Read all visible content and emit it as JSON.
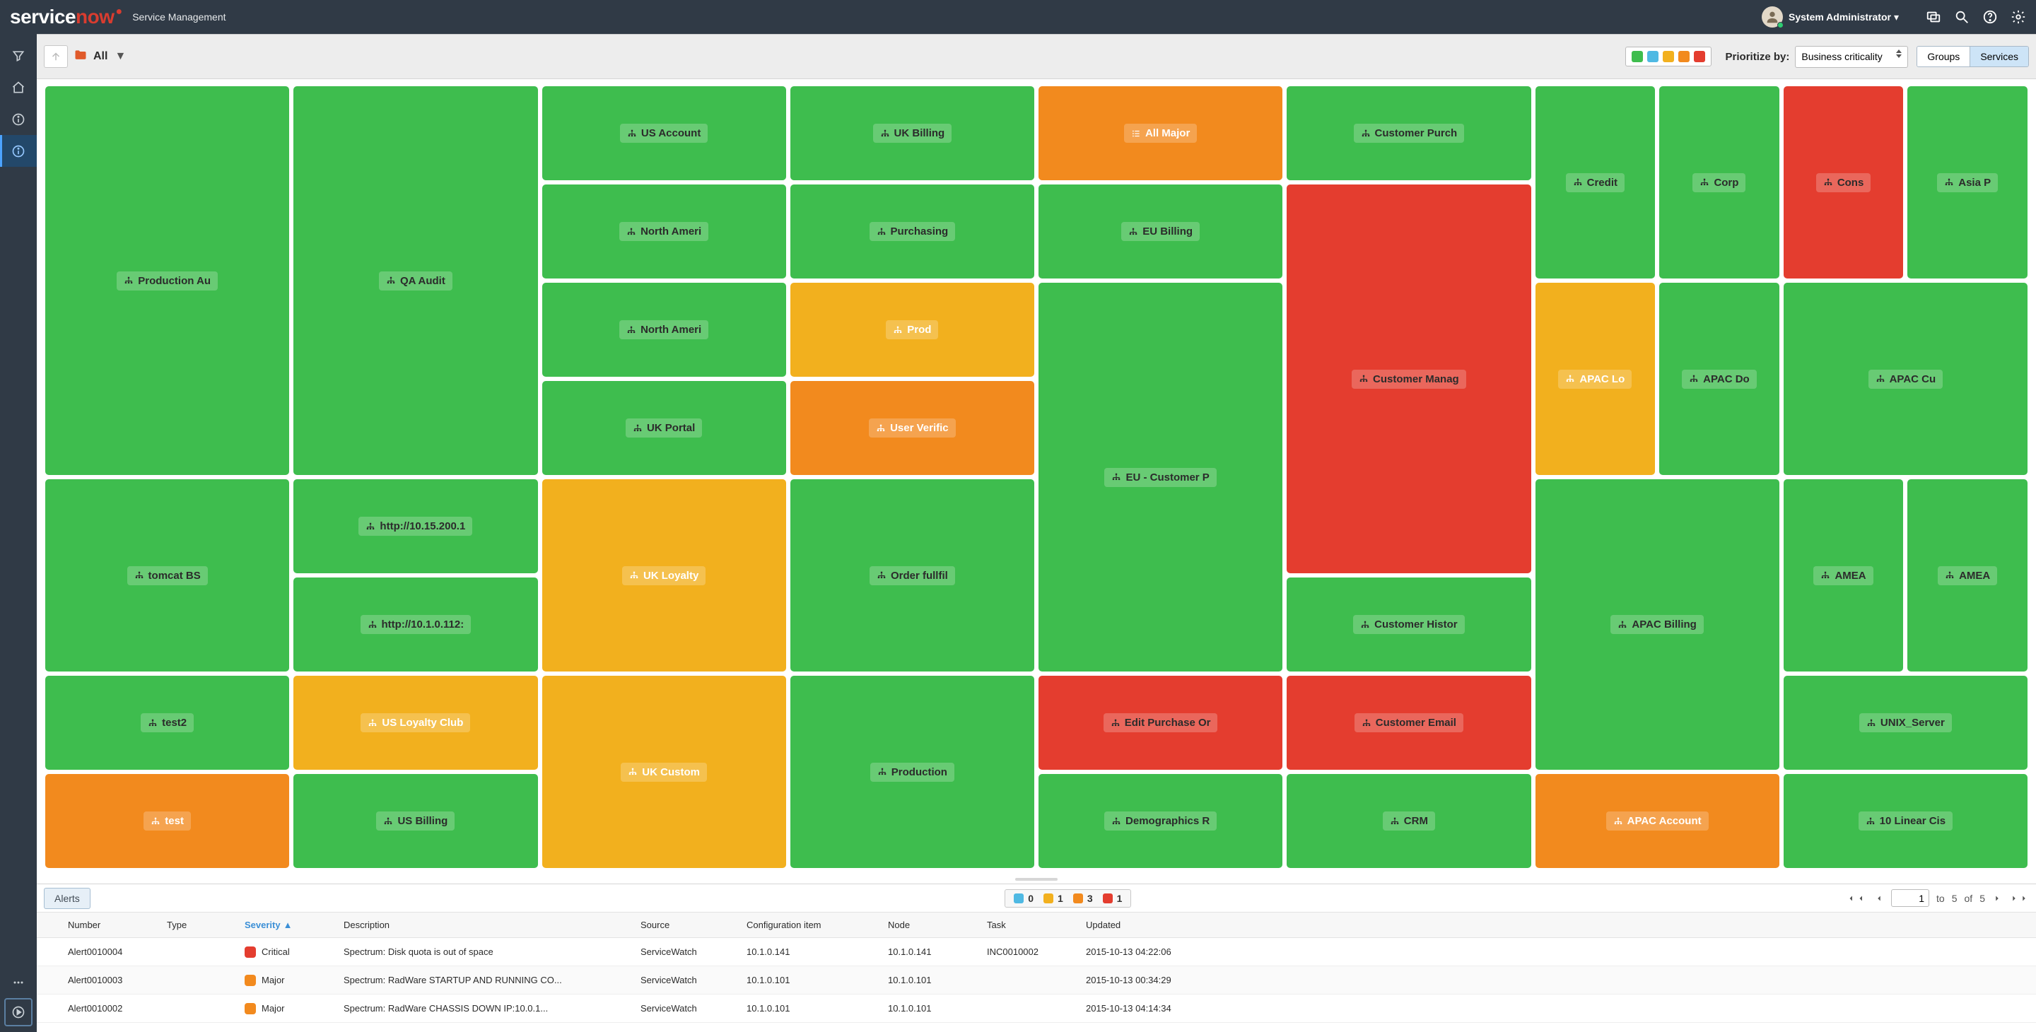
{
  "header": {
    "brand1": "service",
    "brand2": "now",
    "app_title": "Service Management",
    "user": "System Administrator"
  },
  "toolbar": {
    "breadcrumb": "All",
    "prioritize_label": "Prioritize by:",
    "prioritize_value": "Business criticality",
    "btn_groups": "Groups",
    "btn_services": "Services"
  },
  "tiles": [
    {
      "id": "t1",
      "label": "Production Au",
      "color": "tg",
      "col": "1 / 3",
      "row": "1 / 5"
    },
    {
      "id": "t2",
      "label": "QA Audit",
      "color": "tg",
      "col": "3 / 5",
      "row": "1 / 5"
    },
    {
      "id": "t3",
      "label": "US Account",
      "color": "tg",
      "col": "5 / 7",
      "row": "1 / 2"
    },
    {
      "id": "t4",
      "label": "UK Billing",
      "color": "tg",
      "col": "7 / 9",
      "row": "1 / 2"
    },
    {
      "id": "t5",
      "label": "All Major",
      "color": "to",
      "col": "9 / 11",
      "row": "1 / 2",
      "listicon": true
    },
    {
      "id": "t6",
      "label": "Customer Purch",
      "color": "tg",
      "col": "11 / 13",
      "row": "1 / 2"
    },
    {
      "id": "t7",
      "label": "Credit",
      "color": "tg",
      "col": "13 / 14",
      "row": "1 / 3"
    },
    {
      "id": "t8",
      "label": "Corp",
      "color": "tg",
      "col": "14 / 15",
      "row": "1 / 3"
    },
    {
      "id": "t9",
      "label": "Cons",
      "color": "tr",
      "col": "15 / 16",
      "row": "1 / 3"
    },
    {
      "id": "t10",
      "label": "Asia P",
      "color": "tg",
      "col": "16 / 17",
      "row": "1 / 3"
    },
    {
      "id": "t11",
      "label": "North Ameri",
      "color": "tg",
      "col": "5 / 7",
      "row": "2 / 3"
    },
    {
      "id": "t12",
      "label": "Purchasing",
      "color": "tg",
      "col": "7 / 9",
      "row": "2 / 3"
    },
    {
      "id": "t13",
      "label": "EU Billing",
      "color": "tg",
      "col": "9 / 11",
      "row": "2 / 3"
    },
    {
      "id": "t14",
      "label": "Customer Manag",
      "color": "tr",
      "col": "11 / 13",
      "row": "2 / 6"
    },
    {
      "id": "t15",
      "label": "North Ameri",
      "color": "tg",
      "col": "5 / 7",
      "row": "3 / 4"
    },
    {
      "id": "t16",
      "label": "Prod",
      "color": "ty",
      "col": "7 / 9",
      "row": "3 / 4"
    },
    {
      "id": "t17",
      "label": "EU - Customer P",
      "color": "tg",
      "col": "9 / 11",
      "row": "3 / 7"
    },
    {
      "id": "t18",
      "label": "APAC Lo",
      "color": "ty",
      "col": "13 / 14",
      "row": "3 / 5"
    },
    {
      "id": "t19",
      "label": "APAC Do",
      "color": "tg",
      "col": "14 / 15",
      "row": "3 / 5"
    },
    {
      "id": "t20",
      "label": "APAC Cu",
      "color": "tg",
      "col": "15 / 17",
      "row": "3 / 5"
    },
    {
      "id": "t21",
      "label": "http://10.15.200.1",
      "color": "tg",
      "col": "3 / 5",
      "row": "5 / 6"
    },
    {
      "id": "t22",
      "label": "UK Portal",
      "color": "tg",
      "col": "5 / 7",
      "row": "4 / 5"
    },
    {
      "id": "t23",
      "label": "User Verific",
      "color": "to",
      "col": "7 / 9",
      "row": "4 / 5"
    },
    {
      "id": "t24",
      "label": "tomcat BS",
      "color": "tg",
      "col": "1 / 3",
      "row": "5 / 7"
    },
    {
      "id": "t25",
      "label": "http://10.1.0.112:",
      "color": "tg",
      "col": "3 / 5",
      "row": "6 / 7"
    },
    {
      "id": "t26",
      "label": "UK Loyalty",
      "color": "ty",
      "col": "5 / 7",
      "row": "5 / 7"
    },
    {
      "id": "t27",
      "label": "Order fullfil",
      "color": "tg",
      "col": "7 / 9",
      "row": "5 / 7"
    },
    {
      "id": "t28",
      "label": "Customer Histor",
      "color": "tg",
      "col": "11 / 13",
      "row": "6 / 7"
    },
    {
      "id": "t29",
      "label": "APAC Billing",
      "color": "tg",
      "col": "13 / 15",
      "row": "5 / 8"
    },
    {
      "id": "t30",
      "label": "AMEA",
      "color": "tg",
      "col": "15 / 16",
      "row": "5 / 7"
    },
    {
      "id": "t31",
      "label": "AMEA",
      "color": "tg",
      "col": "16 / 17",
      "row": "5 / 7"
    },
    {
      "id": "t32",
      "label": "test2",
      "color": "tg",
      "col": "1 / 3",
      "row": "7 / 8"
    },
    {
      "id": "t33",
      "label": "US Loyalty Club",
      "color": "ty",
      "col": "3 / 5",
      "row": "7 / 8"
    },
    {
      "id": "t34",
      "label": "UK Custom",
      "color": "ty",
      "col": "5 / 7",
      "row": "7 / 9"
    },
    {
      "id": "t35",
      "label": "Production",
      "color": "tg",
      "col": "7 / 9",
      "row": "7 / 9"
    },
    {
      "id": "t36",
      "label": "Edit Purchase Or",
      "color": "tr",
      "col": "9 / 11",
      "row": "7 / 8"
    },
    {
      "id": "t37",
      "label": "Customer Email",
      "color": "tr",
      "col": "11 / 13",
      "row": "7 / 8"
    },
    {
      "id": "t38",
      "label": "UNIX_Server",
      "color": "tg",
      "col": "15 / 17",
      "row": "7 / 8"
    },
    {
      "id": "t39",
      "label": "test",
      "color": "to",
      "col": "1 / 3",
      "row": "8 / 9"
    },
    {
      "id": "t40",
      "label": "US Billing",
      "color": "tg",
      "col": "3 / 5",
      "row": "8 / 9"
    },
    {
      "id": "t41",
      "label": "Demographics R",
      "color": "tg",
      "col": "9 / 11",
      "row": "8 / 9"
    },
    {
      "id": "t42",
      "label": "CRM",
      "color": "tg",
      "col": "11 / 13",
      "row": "8 / 9"
    },
    {
      "id": "t43",
      "label": "APAC Account",
      "color": "to",
      "col": "13 / 15",
      "row": "8 / 9"
    },
    {
      "id": "t44",
      "label": "10 Linear Cis",
      "color": "tg",
      "col": "15 / 17",
      "row": "8 / 9"
    }
  ],
  "alerts": {
    "tab_label": "Alerts",
    "counts": {
      "blue": "0",
      "yellow": "1",
      "orange": "3",
      "red": "1"
    },
    "page_info_to": "to",
    "page_info_of": "of",
    "page_cur": "1",
    "page_to": "5",
    "page_total": "5",
    "cols": {
      "number": "Number",
      "type": "Type",
      "severity": "Severity",
      "description": "Description",
      "source": "Source",
      "ci": "Configuration item",
      "node": "Node",
      "task": "Task",
      "updated": "Updated"
    },
    "rows": [
      {
        "number": "Alert0010004",
        "type": "",
        "sev": "Critical",
        "sevc": "r",
        "desc": "Spectrum: Disk quota is out of space",
        "source": "ServiceWatch",
        "ci": "10.1.0.141",
        "node": "10.1.0.141",
        "task": "INC0010002",
        "updated": "2015-10-13 04:22:06"
      },
      {
        "number": "Alert0010003",
        "type": "",
        "sev": "Major",
        "sevc": "o",
        "desc": "Spectrum: RadWare STARTUP AND RUNNING CO...",
        "source": "ServiceWatch",
        "ci": "10.1.0.101",
        "node": "10.1.0.101",
        "task": "",
        "updated": "2015-10-13 00:34:29"
      },
      {
        "number": "Alert0010002",
        "type": "",
        "sev": "Major",
        "sevc": "o",
        "desc": "Spectrum: RadWare CHASSIS DOWN IP:10.0.1...",
        "source": "ServiceWatch",
        "ci": "10.1.0.101",
        "node": "10.1.0.101",
        "task": "",
        "updated": "2015-10-13 04:14:34"
      }
    ]
  }
}
